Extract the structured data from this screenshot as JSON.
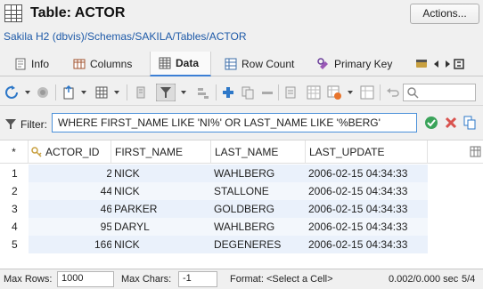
{
  "header": {
    "title": "Table: ACTOR",
    "actions_label": "Actions...",
    "breadcrumb": "Sakila H2 (dbvis)/Schemas/SAKILA/Tables/ACTOR"
  },
  "tabs": [
    {
      "label": "Info",
      "icon": "info-icon"
    },
    {
      "label": "Columns",
      "icon": "columns-icon"
    },
    {
      "label": "Data",
      "icon": "data-grid-icon",
      "active": true
    },
    {
      "label": "Row Count",
      "icon": "row-count-icon"
    },
    {
      "label": "Primary Key",
      "icon": "primary-key-icon"
    }
  ],
  "filter": {
    "label": "Filter:",
    "value": "WHERE FIRST_NAME LIKE 'NI%' OR LAST_NAME LIKE '%BERG'"
  },
  "grid": {
    "corner": "*",
    "columns": [
      "ACTOR_ID",
      "FIRST_NAME",
      "LAST_NAME",
      "LAST_UPDATE"
    ],
    "rows": [
      {
        "num": "1",
        "actor_id": "2",
        "first_name": "NICK",
        "last_name": "WAHLBERG",
        "last_update": "2006-02-15 04:34:33"
      },
      {
        "num": "2",
        "actor_id": "44",
        "first_name": "NICK",
        "last_name": "STALLONE",
        "last_update": "2006-02-15 04:34:33"
      },
      {
        "num": "3",
        "actor_id": "46",
        "first_name": "PARKER",
        "last_name": "GOLDBERG",
        "last_update": "2006-02-15 04:34:33"
      },
      {
        "num": "4",
        "actor_id": "95",
        "first_name": "DARYL",
        "last_name": "WAHLBERG",
        "last_update": "2006-02-15 04:34:33"
      },
      {
        "num": "5",
        "actor_id": "166",
        "first_name": "NICK",
        "last_name": "DEGENERES",
        "last_update": "2006-02-15 04:34:33"
      }
    ]
  },
  "status": {
    "max_rows_label": "Max Rows:",
    "max_rows_value": "1000",
    "max_chars_label": "Max Chars:",
    "max_chars_value": "-1",
    "format_text": "Format: <Select a Cell>",
    "timing": "0.002/0.000 sec",
    "row_count": "5/4"
  },
  "colors": {
    "accent": "#3c7fd5",
    "link": "#1e5aa8",
    "refresh": "#2e78c8",
    "add": "#2e78c8",
    "apply": "#3aa35a",
    "clear": "#d9534f"
  }
}
